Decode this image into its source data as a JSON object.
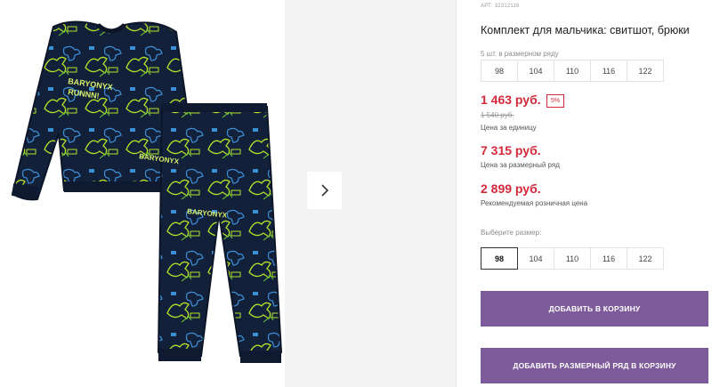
{
  "product": {
    "sku": "АРТ: 32312116",
    "title": "Комплект для мальчика: свитшот, брюки",
    "pack_note": "5 шт. в размерном ряду",
    "pack_sizes": [
      "98",
      "104",
      "110",
      "116",
      "122"
    ],
    "price": "1 463 руб.",
    "discount": "5%",
    "old_price": "1 540 руб.",
    "unit_price_label": "Цена за единицу",
    "pack_price": "7 315 руб.",
    "pack_price_label": "Цена за размерный ряд",
    "rrp_price": "2 899 руб.",
    "rrp_label": "Рекомендуемая розничная цена",
    "choose_size_label": "Выберите размер:",
    "sizes": [
      "98",
      "104",
      "110",
      "116",
      "122"
    ],
    "selected_size": "98",
    "add_to_cart": "ДОБАВИТЬ В КОРЗИНУ",
    "add_pack_to_cart": "ДОБАВИТЬ РАЗМЕРНЫЙ РЯД В КОРЗИНУ"
  },
  "gallery": {
    "next_icon": "chevron-right-icon",
    "print_text": "BARYONYX RUNNN!"
  },
  "colors": {
    "accent_button": "#7d5a99",
    "price_red": "#d3293b",
    "garment_navy": "#13203a",
    "print_lime": "#b5e02a",
    "print_blue": "#3d8fd6"
  }
}
